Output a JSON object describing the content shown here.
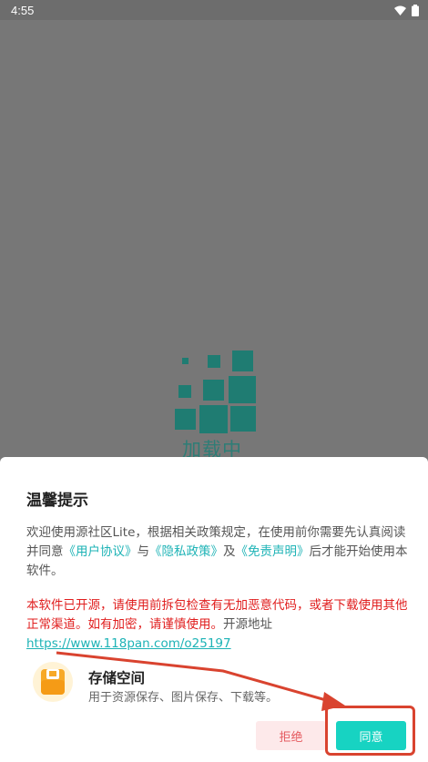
{
  "status_bar": {
    "time": "4:55",
    "icons": [
      "wifi-icon",
      "battery-icon"
    ]
  },
  "loading": {
    "text": "加载中"
  },
  "dialog": {
    "title": "温馨提示",
    "intro_before": "欢迎使用源社区Lite，根据相关政策规定，在使用前你需要先认真阅读并同意",
    "link_user_agreement": "《用户协议》",
    "and1": "与",
    "link_privacy": "《隐私政策》",
    "and2": "及",
    "link_disclaimer": "《免责声明》",
    "intro_after": "后才能开始使用本软件。",
    "warning": "本软件已开源，请使用前拆包检查有无加恶意代码，或者下载使用其他正常渠道。如有加密，请谨慎使用。",
    "source_label": "开源地址",
    "source_url": "https://www.118pan.com/o25197",
    "permission": {
      "icon": "folder-icon",
      "title": "存储空间",
      "description": "用于资源保存、图片保存、下载等。"
    },
    "reject_label": "拒绝",
    "accept_label": "同意"
  },
  "colors": {
    "accent": "#17d3c2",
    "link": "#1db3b6",
    "warning": "#e01e1e",
    "reject_bg": "#fde9ea",
    "annotation": "#d9432f"
  }
}
